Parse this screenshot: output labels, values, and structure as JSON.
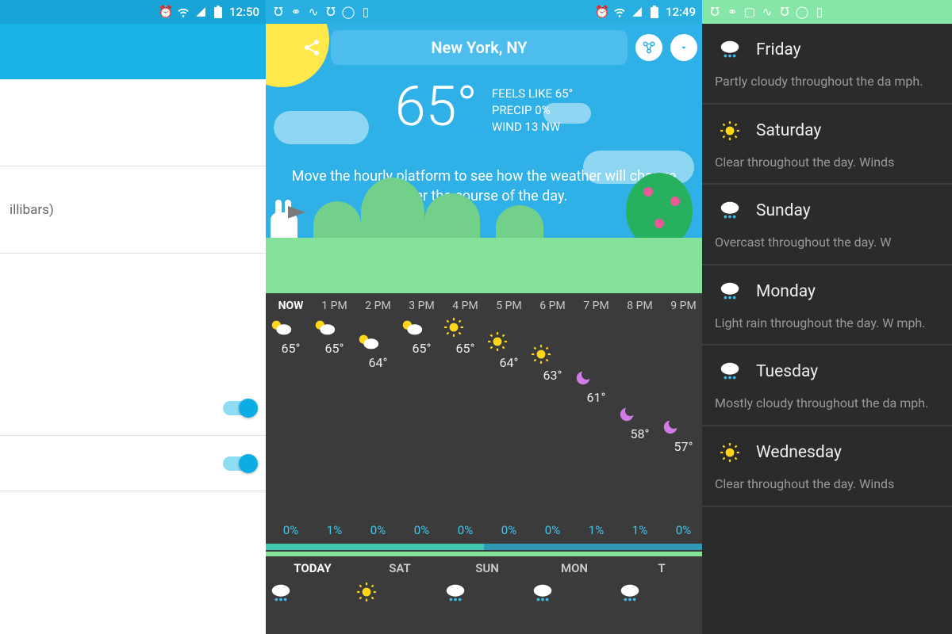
{
  "pane1": {
    "status_time": "12:50",
    "setting_text": "illibars)",
    "toggles": [
      true,
      true
    ]
  },
  "pane2": {
    "status_time": "12:49",
    "location": "New York, NY",
    "temp": "65°",
    "feels": "FEELS LIKE 65°",
    "precip": "PRECIP 0%",
    "wind": "WIND 13 NW",
    "hero_msg": "Move the hourly platform to see how the weather will change over the course of the day.",
    "hours": [
      {
        "label": "NOW",
        "icon": "pc",
        "temp": "65°",
        "precip": "0%"
      },
      {
        "label": "1 PM",
        "icon": "pc",
        "temp": "65°",
        "precip": "1%"
      },
      {
        "label": "2 PM",
        "icon": "pc",
        "temp": "64°",
        "precip": "0%"
      },
      {
        "label": "3 PM",
        "icon": "pc",
        "temp": "65°",
        "precip": "0%"
      },
      {
        "label": "4 PM",
        "icon": "sunny",
        "temp": "65°",
        "precip": "0%"
      },
      {
        "label": "5 PM",
        "icon": "sunny",
        "temp": "64°",
        "precip": "0%"
      },
      {
        "label": "6 PM",
        "icon": "sunny",
        "temp": "63°",
        "precip": "0%"
      },
      {
        "label": "7 PM",
        "icon": "moon",
        "temp": "61°",
        "precip": "1%"
      },
      {
        "label": "8 PM",
        "icon": "moon",
        "temp": "58°",
        "precip": "1%"
      },
      {
        "label": "9 PM",
        "icon": "moon",
        "temp": "57°",
        "precip": "0%"
      }
    ],
    "days": [
      {
        "label": "TODAY",
        "icon": "rainy"
      },
      {
        "label": "SAT",
        "icon": "sunny"
      },
      {
        "label": "SUN",
        "icon": "rainy"
      },
      {
        "label": "MON",
        "icon": "rainy"
      },
      {
        "label": "T",
        "icon": "rainy"
      }
    ]
  },
  "pane3": {
    "days": [
      {
        "name": "Friday",
        "icon": "rainy",
        "desc": "Partly cloudy throughout the da mph."
      },
      {
        "name": "Saturday",
        "icon": "sunny",
        "desc": "Clear throughout the day. Winds"
      },
      {
        "name": "Sunday",
        "icon": "rainy",
        "desc": "Overcast throughout the day. W"
      },
      {
        "name": "Monday",
        "icon": "rainy",
        "desc": "Light rain throughout the day. W mph."
      },
      {
        "name": "Tuesday",
        "icon": "rainy",
        "desc": "Mostly cloudy throughout the da mph."
      },
      {
        "name": "Wednesday",
        "icon": "sunny",
        "desc": "Clear throughout the day. Winds"
      }
    ]
  }
}
